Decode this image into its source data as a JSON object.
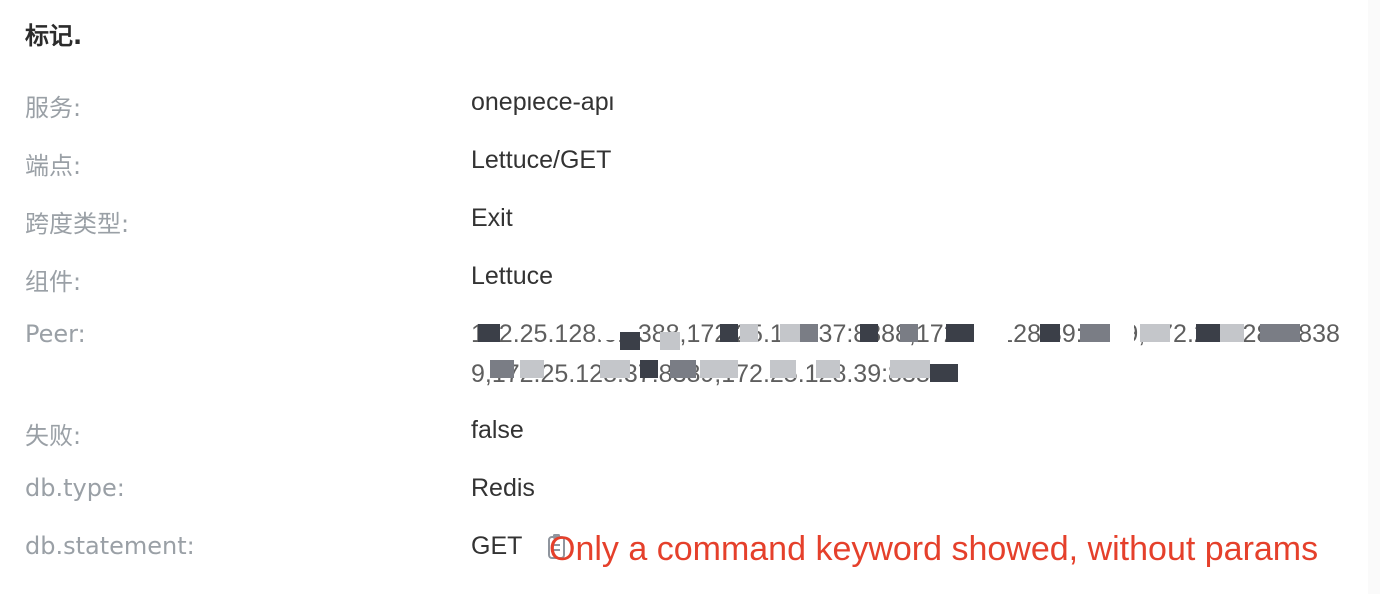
{
  "section": {
    "title": "标记."
  },
  "tags": [
    {
      "label": "服务:",
      "value": "onepiece-api"
    },
    {
      "label": "端点:",
      "value": "Lettuce/GET"
    },
    {
      "label": "跨度类型:",
      "value": "Exit"
    },
    {
      "label": "组件:",
      "value": "Lettuce"
    },
    {
      "label": "Peer:",
      "value": "172.25.128.6:8388,172.25.128.37:8388,172.25.128.39:8389,172.25.128.6:8389,172.25.128.37:8389,172.25.128.39:8389"
    },
    {
      "label": "失败:",
      "value": "false"
    },
    {
      "label": "db.type:",
      "value": "Redis"
    },
    {
      "label": "db.statement:",
      "value": "GET"
    }
  ],
  "annotation": {
    "text": "Only a command keyword showed, without params",
    "color": "#e5402b"
  },
  "colors": {
    "label": "#9aa0a6",
    "value": "#333333",
    "redaction_dark": "#3b3f48",
    "redaction_mid": "#7a7d85",
    "redaction_light": "#c4c6ca"
  },
  "icons": {
    "copy": "copy-icon"
  }
}
